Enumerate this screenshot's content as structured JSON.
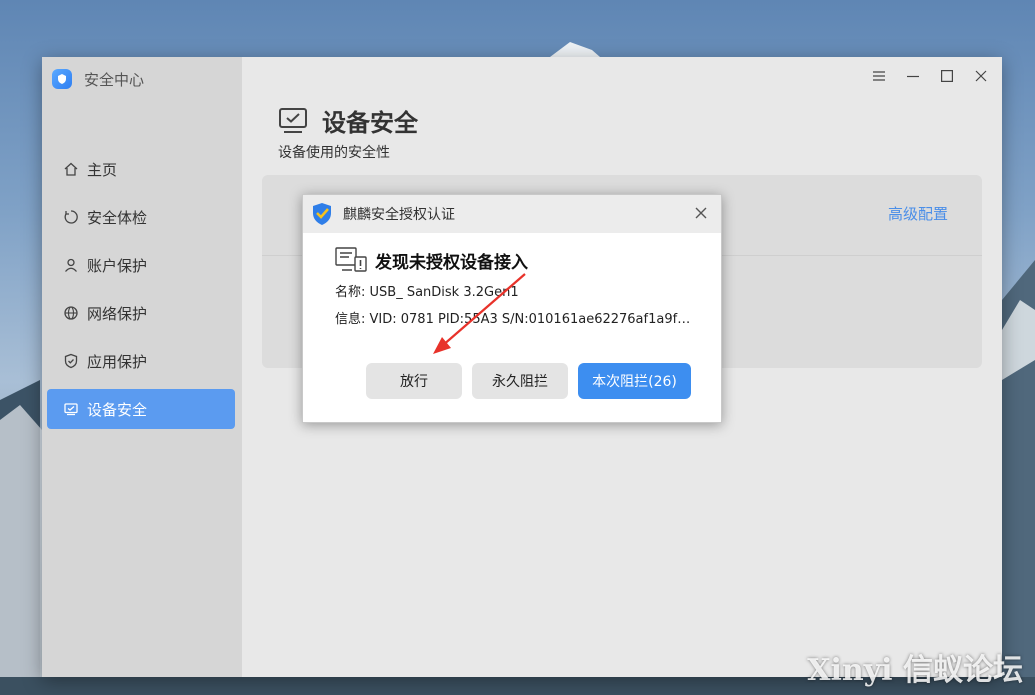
{
  "app": {
    "title": "安全中心"
  },
  "window_controls": [
    "menu-icon",
    "minimize-icon",
    "maximize-icon",
    "close-icon"
  ],
  "sidebar": {
    "items": [
      {
        "label": "主页",
        "icon": "home-icon",
        "active": false
      },
      {
        "label": "安全体检",
        "icon": "scan-icon",
        "active": false
      },
      {
        "label": "账户保护",
        "icon": "user-icon",
        "active": false
      },
      {
        "label": "网络保护",
        "icon": "globe-icon",
        "active": false
      },
      {
        "label": "应用保护",
        "icon": "shield-icon",
        "active": false
      },
      {
        "label": "设备安全",
        "icon": "device-icon",
        "active": true
      }
    ]
  },
  "page": {
    "title": "设备安全",
    "subtitle": "设备使用的安全性",
    "advanced_link": "高级配置"
  },
  "dialog": {
    "title": "麒麟安全授权认证",
    "heading": "发现未授权设备接入",
    "name_line": "名称: USB_ SanDisk 3.2Gen1",
    "info_line": "信息: VID: 0781   PID:55A3   S/N:010161ae62276af1a9f…",
    "buttons": {
      "allow": "放行",
      "block_forever": "永久阻拦",
      "block_once": "本次阻拦(26)"
    }
  },
  "watermark": "Xinyi 信蚁论坛",
  "colors": {
    "accent": "#3d8ef0",
    "sidebar_active": "#5b9bf0",
    "arrow": "#e8322a"
  }
}
